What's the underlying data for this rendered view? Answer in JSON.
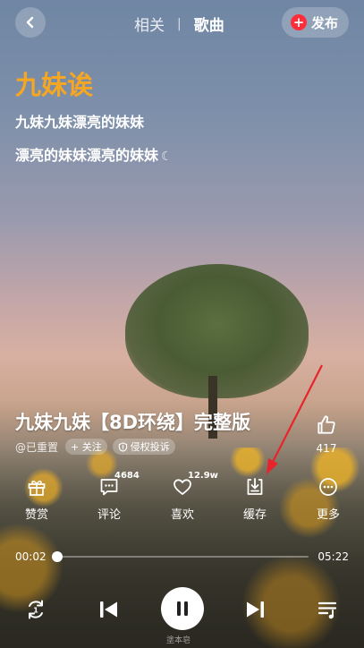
{
  "header": {
    "back_icon": "chevron-left-icon",
    "tabs": [
      {
        "label": "相关"
      },
      {
        "label": "歌曲"
      }
    ],
    "active_tab": "歌曲",
    "publish_label": "发布",
    "publish_icon": "plus-circle-icon"
  },
  "lyrics": {
    "heading": "九妹诶",
    "line1": "九妹九妹漂亮的妹妹",
    "line2": "漂亮的妹妹漂亮的妹妹"
  },
  "song": {
    "title": "九妹九妹【8D环绕】完整版",
    "author": "@已重置",
    "follow_label": "+ 关注",
    "report_label": "侵权投诉",
    "side_like_count": "417"
  },
  "actions": [
    {
      "label": "赞赏",
      "icon": "gift-icon",
      "badge": ""
    },
    {
      "label": "评论",
      "icon": "comment-icon",
      "badge": "4684"
    },
    {
      "label": "喜欢",
      "icon": "heart-icon",
      "badge": "12.9w"
    },
    {
      "label": "缓存",
      "icon": "download-icon",
      "badge": ""
    },
    {
      "label": "更多",
      "icon": "more-icon",
      "badge": ""
    }
  ],
  "player": {
    "current_time": "00:02",
    "total_time": "05:22",
    "progress": 0.006
  },
  "controls": {
    "repeat_icon": "repeat-one-icon",
    "prev_icon": "skip-previous-icon",
    "play_state": "playing",
    "next_icon": "skip-next-icon",
    "playlist_icon": "playlist-icon"
  },
  "watermark": "塗本皂",
  "colors": {
    "accent_orange": "#f5a623",
    "publish_red": "#ff2d3a",
    "annotation_red": "#e8232a"
  }
}
